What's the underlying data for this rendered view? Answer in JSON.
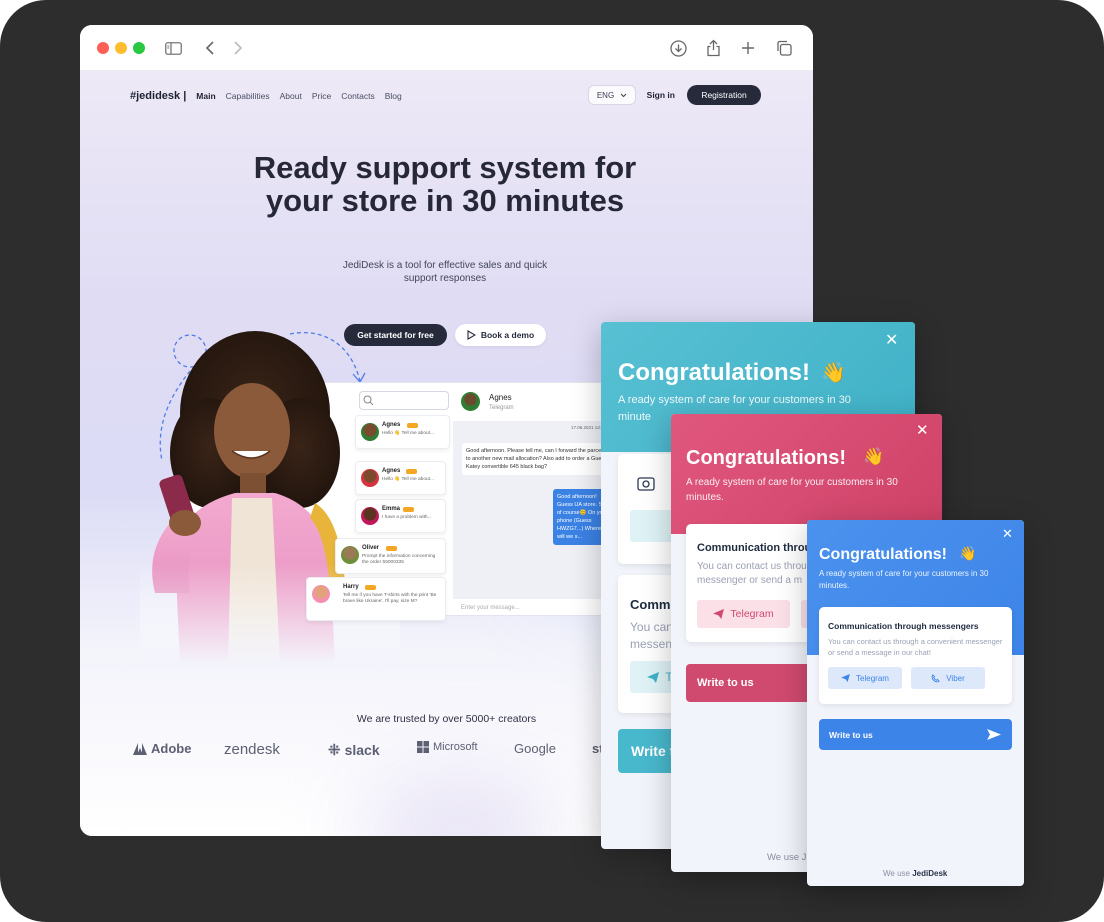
{
  "site": {
    "logo": "#jedidesk |",
    "nav": [
      "Main",
      "Capabilities",
      "About",
      "Price",
      "Contacts",
      "Blog"
    ],
    "lang": "ENG",
    "signin": "Sign in",
    "registration": "Registration",
    "hero_title": "Ready support system for your store in 30 minutes",
    "hero_sub": "JediDesk is a tool for effective sales and quick support responses",
    "cta_primary": "Get started for free",
    "cta_secondary": "Book a demo",
    "trusted": "We are trusted by over 5000+ creators",
    "brands": [
      "Adobe",
      "zendesk",
      "slack",
      "Microsoft",
      "Google",
      "st"
    ]
  },
  "app": {
    "chats": [
      {
        "name": "Agnes",
        "preview": "Hello 👋 Tell me about..."
      },
      {
        "name": "Emma",
        "preview": "I have a problem with..."
      },
      {
        "name": "Oliver",
        "preview": "Prompt the information concerning the order 55000335"
      },
      {
        "name": "Harry",
        "preview": "Tell me if you have T-shirts with the print 'Be brave like Ukraine', I'll pay, size M?"
      }
    ],
    "active_name": "Agnes",
    "active_channel": "Telegram",
    "timestamp": "17.06.2021  13:43",
    "msg_in": "Good afternoon. Please tell me, can I forward the parcel to another new mail allocation? Also add to order a Guess Katey convertible 645 black bag?",
    "msg_out": "Good afternoon! Guess UA store. So of course😊 On your phone (Guess HWZG7...) Where will we s...",
    "input_placeholder": "Enter your message..."
  },
  "popups": [
    {
      "title": "Congratulations!",
      "emoji": "👋",
      "subtitle": "A ready system of care for your customers in 30 minute",
      "card2_title": "Comm",
      "card2_text": "You can messen",
      "tg_short": "T",
      "write": "Write t"
    },
    {
      "title": "Congratulations!",
      "emoji": "👋",
      "subtitle": "A ready system of care for your customers in 30 minutes.",
      "card_title": "Communication throu",
      "card_text": "You can contact us throu messenger or send a m",
      "telegram": "Telegram",
      "write": "Write to us",
      "footer": "We use J"
    },
    {
      "title": "Congratulations!",
      "emoji": "👋",
      "subtitle": "A ready system of care for your customers in 30 minutes.",
      "card_title": "Communication through messengers",
      "card_text": "You can contact us through a convenient messenger or send a message in our chat!",
      "telegram": "Telegram",
      "viber": "Viber",
      "write": "Write to us",
      "footer_pre": "We use ",
      "footer_brand": "JediDesk"
    }
  ],
  "colors": {
    "teal": "#4fbfd0",
    "pink": "#d6496f",
    "blue": "#3d84e8",
    "dark": "#262a3b"
  }
}
